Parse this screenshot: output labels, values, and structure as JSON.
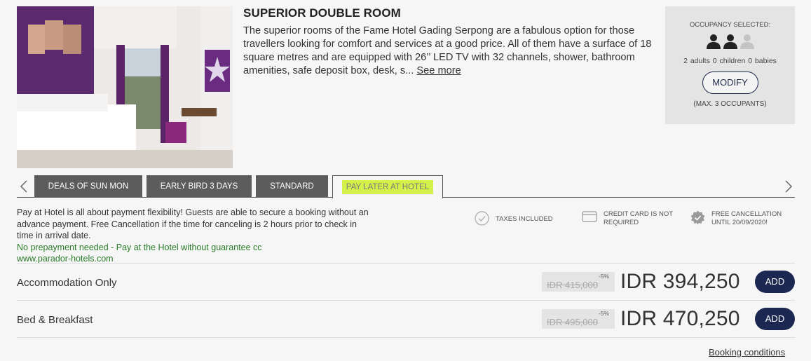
{
  "room": {
    "title": "SUPERIOR DOUBLE ROOM",
    "description": "The superior rooms of the Fame Hotel Gading Serpong are a fabulous option for those travellers looking for comfort and services at a good price. All of them have a surface of 18 square metres and are equipped with 26’’ LED TV with 32 channels, shower, bathroom amenities, safe deposit box, desk, s...",
    "see_more": "See more"
  },
  "occupancy": {
    "title": "OCCUPANCY SELECTED:",
    "counts": "2 adults  0 children  0 babies",
    "modify_label": "MODIFY",
    "max": "(MAX. 3 OCCUPANTS)",
    "icons": [
      "person-icon",
      "person-icon",
      "person-icon-inactive"
    ]
  },
  "tabs": [
    {
      "label": "DEALS OF SUN MON",
      "active": false
    },
    {
      "label": "EARLY BIRD 3 DAYS",
      "active": false
    },
    {
      "label": "STANDARD",
      "active": false
    },
    {
      "label": "PAY LATER AT HOTEL",
      "active": true
    }
  ],
  "rate": {
    "description": "Pay at Hotel is all about payment flexibility! Guests are able to secure a booking without an advance payment. Free Cancellation if the time for canceling is 2 hours prior to check in time in arrival date.",
    "note": "No prepayment needed - Pay at the Hotel without guarantee cc",
    "site": "www.parador-hotels.com"
  },
  "features": [
    {
      "icon": "check-circle-icon",
      "label": "TAXES INCLUDED"
    },
    {
      "icon": "credit-card-icon",
      "label": "CREDIT CARD IS NOT REQUIRED"
    },
    {
      "icon": "badge-check-icon",
      "label": "FREE CANCELLATION UNTIL 20/09/2020!"
    }
  ],
  "boards": [
    {
      "label": "Accommodation Only",
      "discount": "-5%",
      "old_price": "IDR 415,000",
      "price": "IDR 394,250",
      "add_label": "ADD"
    },
    {
      "label": "Bed & Breakfast",
      "discount": "-5%",
      "old_price": "IDR 495,000",
      "price": "IDR 470,250",
      "add_label": "ADD"
    }
  ],
  "booking_conditions": "Booking conditions",
  "colors": {
    "accent_navy": "#1c2851",
    "tab_bg": "#5c5c5c",
    "highlight": "#d4f04a",
    "green_text": "#2a7a2a"
  }
}
